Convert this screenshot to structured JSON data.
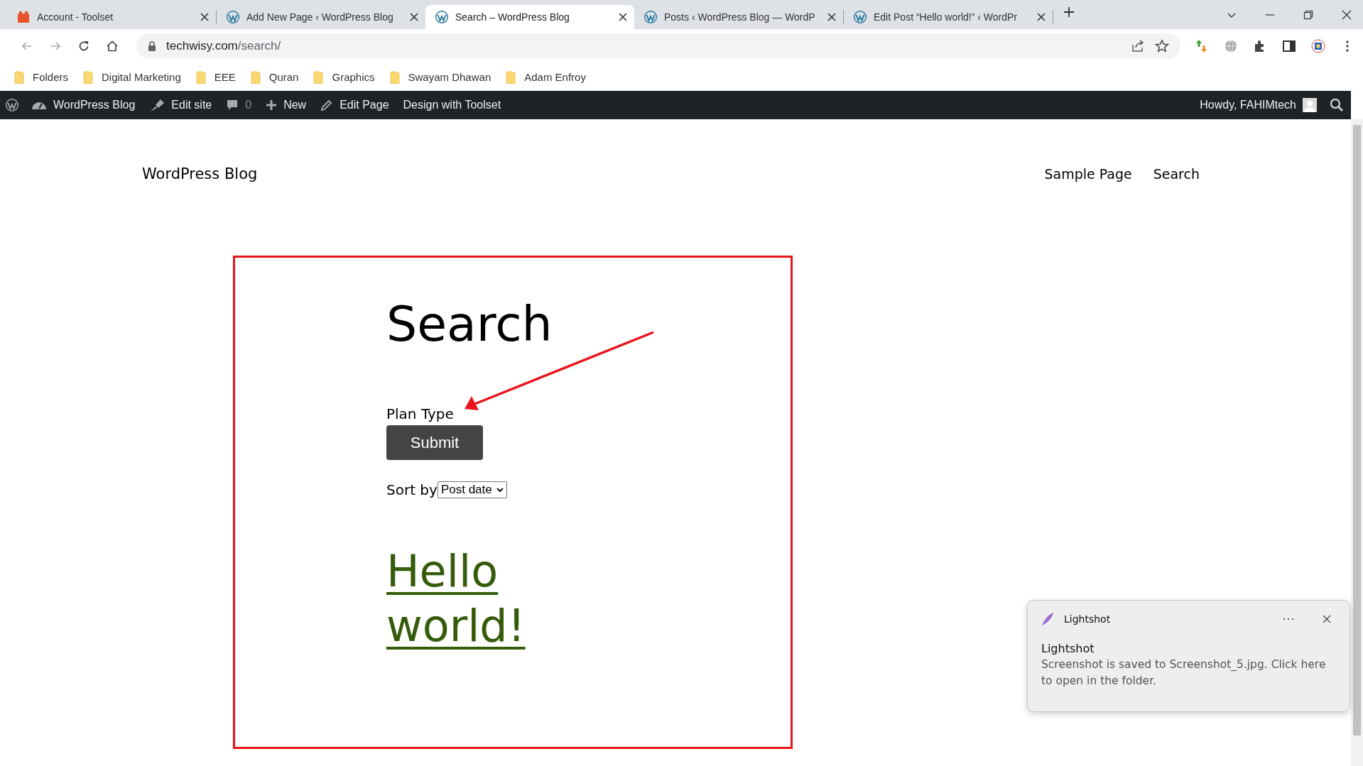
{
  "browser": {
    "tabs": [
      {
        "title": "Account - Toolset",
        "kind": "toolset",
        "selected": false
      },
      {
        "title": "Add New Page ‹ WordPress Blog",
        "kind": "wordpress",
        "selected": false
      },
      {
        "title": "Search – WordPress Blog",
        "kind": "wordpress",
        "selected": true
      },
      {
        "title": "Posts ‹ WordPress Blog — WordP",
        "kind": "wordpress",
        "selected": false
      },
      {
        "title": "Edit Post “Hello world!” ‹ WordPr",
        "kind": "wordpress",
        "selected": false
      }
    ],
    "url": {
      "host": "techwisy.com",
      "path": "/search/"
    },
    "bookmarks": [
      "Folders",
      "Digital Marketing",
      "EEE",
      "Quran",
      "Graphics",
      "Swayam Dhawan",
      "Adam Enfroy"
    ]
  },
  "admin_bar": {
    "items": [
      {
        "kind": "logo"
      },
      {
        "kind": "site",
        "label": "WordPress Blog"
      },
      {
        "kind": "edit-site",
        "label": "Edit site"
      },
      {
        "kind": "comments",
        "label": "0"
      },
      {
        "kind": "new",
        "label": "New"
      },
      {
        "kind": "edit",
        "label": "Edit Page"
      },
      {
        "kind": "text",
        "label": "Design with Toolset"
      }
    ],
    "greeting": "Howdy, FAHIMtech"
  },
  "site": {
    "title": "WordPress Blog",
    "nav": [
      "Sample Page",
      "Search"
    ],
    "heading": "Search",
    "field_label": "Plan Type",
    "submit": "Submit",
    "sort_label": "Sort by",
    "sort_value": "Post date",
    "posts": [
      "Hello world!"
    ]
  },
  "notification": {
    "app": "Lightshot",
    "title": "Lightshot",
    "body": "Screenshot is saved to Screenshot_5.jpg. Click here to open in the folder."
  }
}
